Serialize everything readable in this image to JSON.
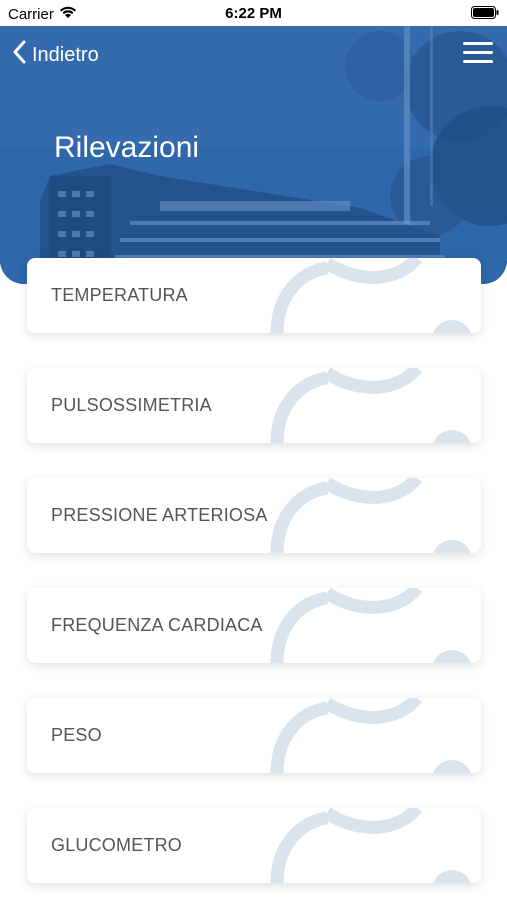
{
  "status_bar": {
    "carrier": "Carrier",
    "time": "6:22 PM"
  },
  "header": {
    "back_label": "Indietro",
    "title": "Rilevazioni",
    "accent_color": "#2d64a8"
  },
  "items": [
    {
      "label": "TEMPERATURA"
    },
    {
      "label": "PULSOSSIMETRIA"
    },
    {
      "label": "PRESSIONE ARTERIOSA"
    },
    {
      "label": "FREQUENZA CARDIACA"
    },
    {
      "label": "PESO"
    },
    {
      "label": "GLUCOMETRO"
    }
  ],
  "icons": {
    "back": "chevron-left-icon",
    "menu": "hamburger-menu-icon",
    "wifi": "wifi-icon",
    "battery": "battery-icon"
  }
}
